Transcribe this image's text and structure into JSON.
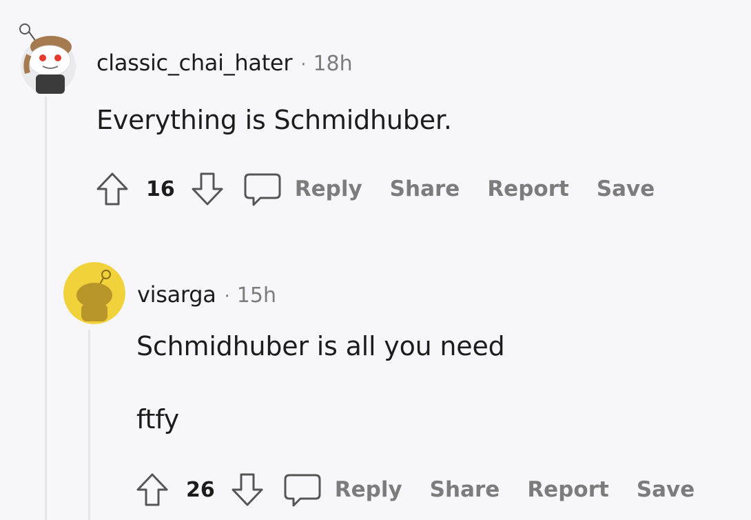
{
  "comments": [
    {
      "username": "classic_chai_hater",
      "separator": "·",
      "time": "18h",
      "body": [
        "Everything is Schmidhuber."
      ],
      "votes": "16",
      "avatar_icon": "snoo-avatar-icon",
      "actions": [
        "Reply",
        "Share",
        "Report",
        "Save"
      ]
    },
    {
      "username": "visarga",
      "separator": "·",
      "time": "15h",
      "body": [
        "Schmidhuber is all you need",
        "ftfy"
      ],
      "votes": "26",
      "avatar_icon": "snoo-avatar-icon",
      "actions": [
        "Reply",
        "Share",
        "Report",
        "Save"
      ]
    }
  ],
  "colors": {
    "background": "#f7f7fb",
    "text": "#1c1c1c",
    "muted": "#7c7c7c",
    "avatar_yellow": "#f2d23a"
  }
}
